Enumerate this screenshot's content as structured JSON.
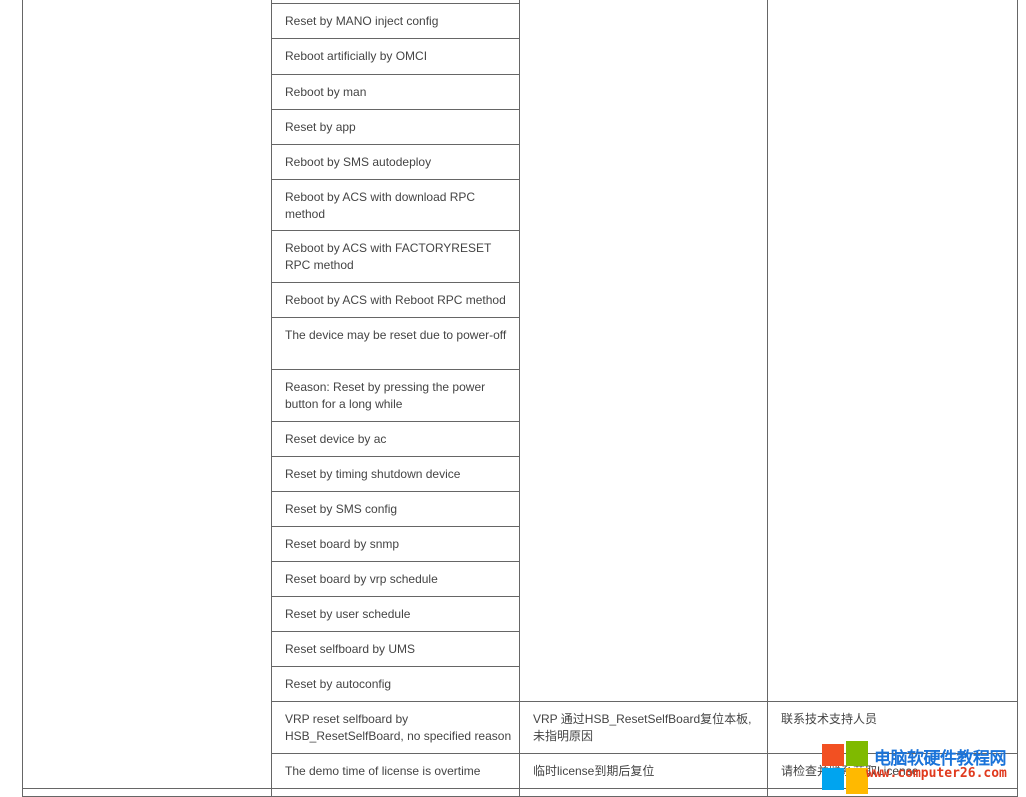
{
  "table": {
    "rows": [
      {
        "cause": "Reset by MANO inject config"
      },
      {
        "cause": "Reboot artificially by OMCI"
      },
      {
        "cause": "Reboot by man"
      },
      {
        "cause": "Reset by app"
      },
      {
        "cause": "Reboot by SMS autodeploy"
      },
      {
        "cause": "Reboot by ACS with download RPC method"
      },
      {
        "cause": "Reboot by ACS with FACTORYRESET RPC method"
      },
      {
        "cause": "Reboot by ACS with Reboot RPC method"
      },
      {
        "cause": "The device may be reset due to power-off"
      },
      {
        "cause": "Reason: Reset by pressing the power button for a long while"
      },
      {
        "cause": "Reset device by ac"
      },
      {
        "cause": "Reset by timing shutdown device"
      },
      {
        "cause": "Reset by SMS config"
      },
      {
        "cause": "Reset board by snmp"
      },
      {
        "cause": "Reset board by vrp schedule"
      },
      {
        "cause": "Reset by user schedule"
      },
      {
        "cause": "Reset selfboard by UMS"
      },
      {
        "cause": "Reset by autoconfig"
      },
      {
        "cause": "VRP reset selfboard by HSB_ResetSelfBoard, no specified reason",
        "description": "VRP 通过HSB_ResetSelfBoard复位本板,未指明原因",
        "action": "联系技术支持人员"
      },
      {
        "cause": "The demo time of license is overtime",
        "description": "临时license到期后复位",
        "action": "请检查并联系获取License"
      }
    ]
  },
  "watermark": {
    "title": "电脑软硬件教程网",
    "url": "www.computer26.com",
    "colors": [
      "#f25022",
      "#7fba00",
      "#00a4ef",
      "#ffb900"
    ]
  }
}
